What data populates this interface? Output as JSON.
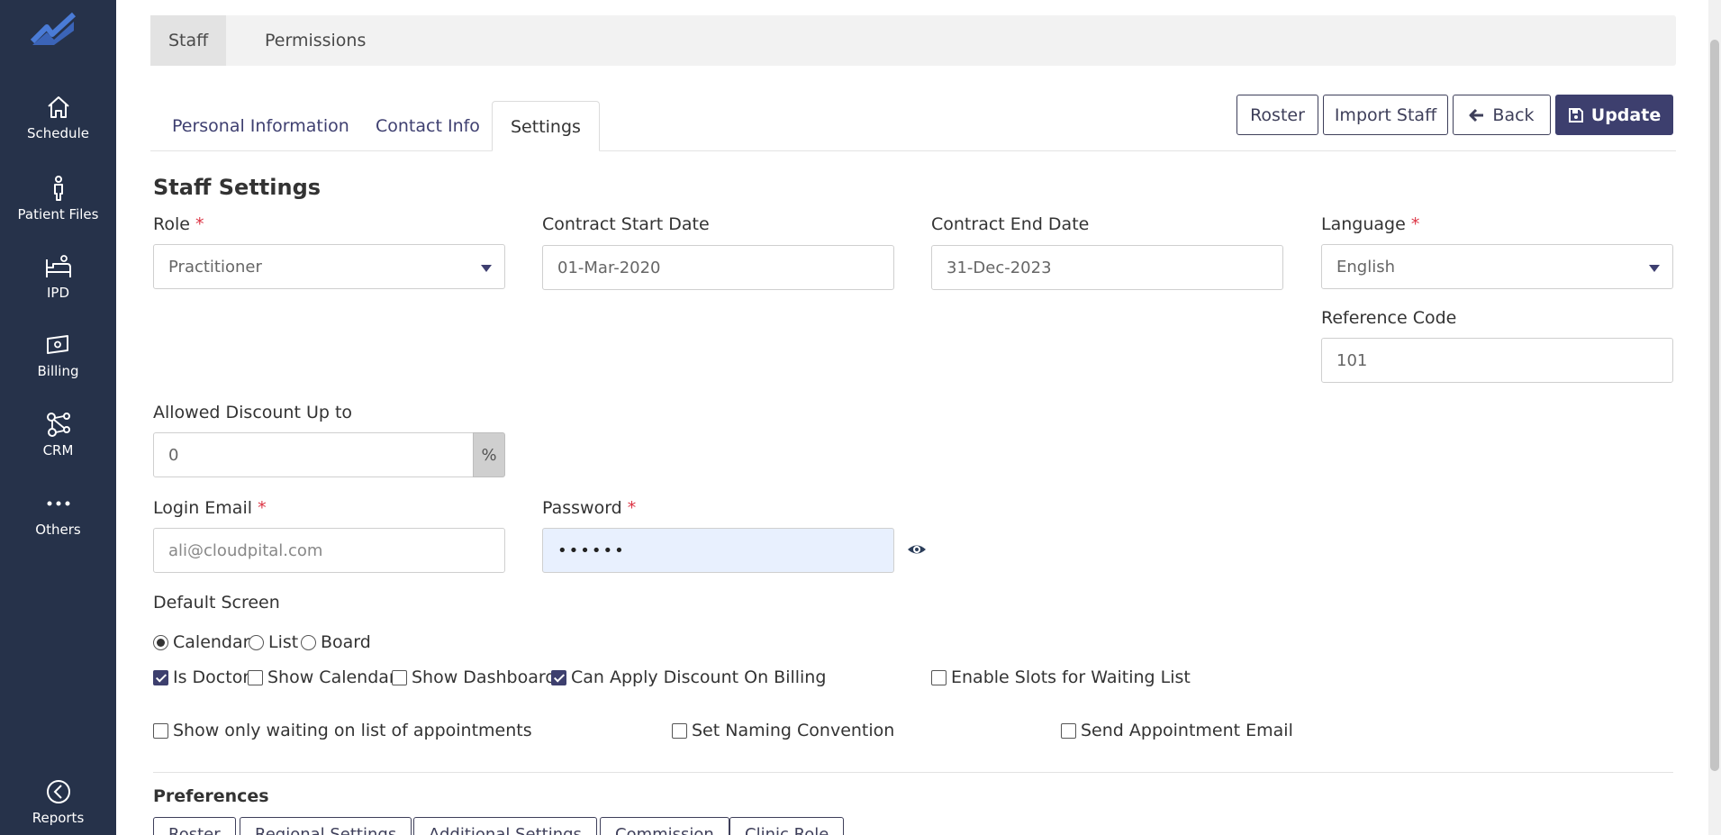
{
  "sidebar": {
    "items": [
      {
        "label": "Schedule",
        "icon": "home-icon"
      },
      {
        "label": "Patient Files",
        "icon": "person-icon"
      },
      {
        "label": "IPD",
        "icon": "bed-icon"
      },
      {
        "label": "Billing",
        "icon": "cash-icon"
      },
      {
        "label": "CRM",
        "icon": "network-icon"
      },
      {
        "label": "Others",
        "icon": "dots-icon"
      },
      {
        "label": "Reports",
        "icon": "reports-icon"
      }
    ]
  },
  "top_tabs": [
    {
      "label": "Staff",
      "active": true
    },
    {
      "label": "Permissions",
      "active": false
    }
  ],
  "sub_tabs": [
    {
      "label": "Personal Information",
      "active": false
    },
    {
      "label": "Contact Info",
      "active": false
    },
    {
      "label": "Settings",
      "active": true
    }
  ],
  "header_buttons": {
    "roster": "Roster",
    "import_staff": "Import Staff",
    "back": "Back",
    "update": "Update"
  },
  "settings": {
    "title": "Staff Settings",
    "role": {
      "label": "Role",
      "required": "*",
      "value": "Practitioner"
    },
    "contract_start": {
      "label": "Contract Start Date",
      "value": "01-Mar-2020"
    },
    "contract_end": {
      "label": "Contract End Date",
      "value": "31-Dec-2023"
    },
    "language": {
      "label": "Language",
      "required": "*",
      "value": "English"
    },
    "reference_code": {
      "label": "Reference Code",
      "value": "101"
    },
    "discount": {
      "label": "Allowed Discount Up to",
      "value": "0",
      "suffix": "%"
    },
    "login_email": {
      "label": "Login Email",
      "required": "*",
      "placeholder": "ali@cloudpital.com"
    },
    "password": {
      "label": "Password",
      "required": "*",
      "value": "••••••"
    },
    "default_screen": {
      "label": "Default Screen",
      "options": [
        {
          "label": "Calendar",
          "selected": true
        },
        {
          "label": "List",
          "selected": false
        },
        {
          "label": "Board",
          "selected": false
        }
      ]
    },
    "checkboxes_row1": [
      {
        "label": "Is Doctor",
        "checked": true
      },
      {
        "label": "Show Calendar",
        "checked": false
      },
      {
        "label": "Show Dashboard",
        "checked": false
      },
      {
        "label": "Can Apply Discount On Billing",
        "checked": true
      },
      {
        "label": "Enable Slots for Waiting List",
        "checked": false
      }
    ],
    "checkboxes_row2": [
      {
        "label": "Show only waiting on list of appointments",
        "checked": false
      },
      {
        "label": "Set Naming Convention",
        "checked": false
      },
      {
        "label": "Send Appointment Email",
        "checked": false
      }
    ]
  },
  "preferences": {
    "title": "Preferences",
    "buttons": [
      "Roster",
      "Regional Settings",
      "Additional Settings",
      "Commission",
      "Clinic Role"
    ]
  },
  "colors": {
    "sidebar_bg": "#26324a",
    "primary": "#3d3f6e",
    "required": "#dc3545",
    "autofill": "#e8f0fe"
  }
}
